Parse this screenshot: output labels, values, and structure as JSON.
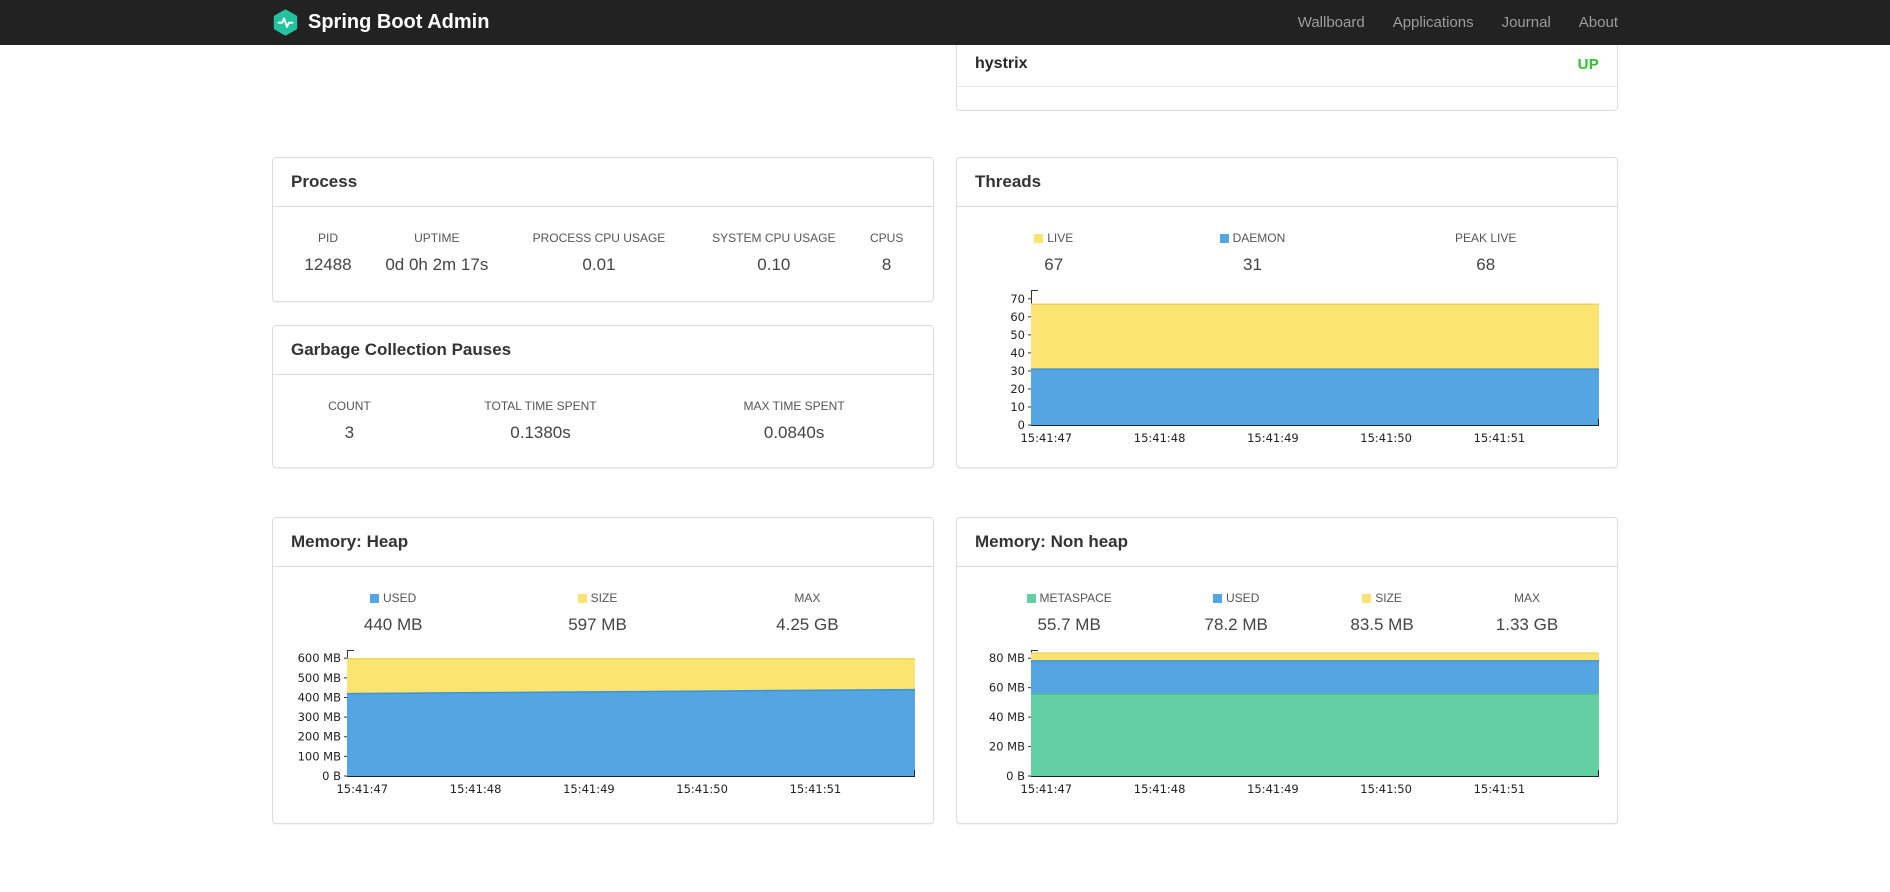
{
  "colors": {
    "brand_teal": "#23c3a0",
    "status_up": "#2dc22d",
    "series_yellow": "#fce473",
    "series_blue": "#53a6e1",
    "series_green": "#63d0a4"
  },
  "navbar": {
    "brand": "Spring Boot Admin",
    "items": [
      "Wallboard",
      "Applications",
      "Journal",
      "About"
    ]
  },
  "health": {
    "service_name": "hystrix",
    "status": "UP"
  },
  "process": {
    "title": "Process",
    "stats": [
      {
        "label": "PID",
        "value": "12488"
      },
      {
        "label": "UPTIME",
        "value": "0d 0h 2m 17s"
      },
      {
        "label": "PROCESS CPU USAGE",
        "value": "0.01"
      },
      {
        "label": "SYSTEM CPU USAGE",
        "value": "0.10"
      },
      {
        "label": "CPUS",
        "value": "8"
      }
    ]
  },
  "gc": {
    "title": "Garbage Collection Pauses",
    "stats": [
      {
        "label": "COUNT",
        "value": "3"
      },
      {
        "label": "TOTAL TIME SPENT",
        "value": "0.1380s"
      },
      {
        "label": "MAX TIME SPENT",
        "value": "0.0840s"
      }
    ]
  },
  "threads": {
    "title": "Threads",
    "legend": [
      {
        "label": "LIVE",
        "value": "67",
        "color": "#fce473"
      },
      {
        "label": "DAEMON",
        "value": "31",
        "color": "#53a6e1"
      },
      {
        "label": "PEAK LIVE",
        "value": "68"
      }
    ]
  },
  "memory_heap": {
    "title": "Memory: Heap",
    "legend": [
      {
        "label": "USED",
        "value": "440 MB",
        "color": "#53a6e1"
      },
      {
        "label": "SIZE",
        "value": "597 MB",
        "color": "#fce473"
      },
      {
        "label": "MAX",
        "value": "4.25 GB"
      }
    ]
  },
  "memory_nonheap": {
    "title": "Memory: Non heap",
    "legend": [
      {
        "label": "METASPACE",
        "value": "55.7 MB",
        "color": "#63d0a4"
      },
      {
        "label": "USED",
        "value": "78.2 MB",
        "color": "#53a6e1"
      },
      {
        "label": "SIZE",
        "value": "83.5 MB",
        "color": "#fce473"
      },
      {
        "label": "MAX",
        "value": "1.33 GB"
      }
    ]
  },
  "chart_data": [
    {
      "id": "threads",
      "type": "area",
      "title": "Threads",
      "xlabel": "",
      "ylabel": "",
      "ylim": [
        0,
        70
      ],
      "grid": false,
      "legend_position": "top",
      "x_labels": [
        "15:41:47",
        "15:41:48",
        "15:41:49",
        "15:41:50",
        "15:41:51"
      ],
      "y_ticks": [
        {
          "value": 0,
          "label": "0"
        },
        {
          "value": 10,
          "label": "10"
        },
        {
          "value": 20,
          "label": "20"
        },
        {
          "value": 30,
          "label": "30"
        },
        {
          "value": 40,
          "label": "40"
        },
        {
          "value": 50,
          "label": "50"
        },
        {
          "value": 60,
          "label": "60"
        },
        {
          "value": 70,
          "label": "70"
        }
      ],
      "series": [
        {
          "name": "LIVE",
          "color": "#fce473",
          "stroke": "#edd45e",
          "values": [
            67,
            67,
            67,
            67,
            67,
            67
          ]
        },
        {
          "name": "DAEMON",
          "color": "#53a6e1",
          "stroke": "#3d94d4",
          "values": [
            31,
            31,
            31,
            31,
            31,
            31
          ]
        }
      ]
    },
    {
      "id": "heap",
      "type": "area",
      "title": "Memory: Heap (values in MB)",
      "xlabel": "",
      "ylabel": "",
      "ylim": [
        0,
        600
      ],
      "grid": false,
      "legend_position": "top",
      "x_labels": [
        "15:41:47",
        "15:41:48",
        "15:41:49",
        "15:41:50",
        "15:41:51"
      ],
      "y_ticks": [
        {
          "value": 0,
          "label": "0 B"
        },
        {
          "value": 100,
          "label": "100 MB"
        },
        {
          "value": 200,
          "label": "200 MB"
        },
        {
          "value": 300,
          "label": "300 MB"
        },
        {
          "value": 400,
          "label": "400 MB"
        },
        {
          "value": 500,
          "label": "500 MB"
        },
        {
          "value": 600,
          "label": "600 MB"
        }
      ],
      "series": [
        {
          "name": "SIZE",
          "color": "#fce473",
          "stroke": "#edd45e",
          "values": [
            597,
            597,
            597,
            597,
            597,
            597
          ]
        },
        {
          "name": "USED",
          "color": "#53a6e1",
          "stroke": "#3d94d4",
          "values": [
            420,
            424,
            428,
            432,
            436,
            440
          ]
        }
      ]
    },
    {
      "id": "nonheap",
      "type": "area",
      "title": "Memory: Non heap (values in MB)",
      "xlabel": "",
      "ylabel": "",
      "ylim": [
        0,
        80
      ],
      "grid": false,
      "legend_position": "top",
      "x_labels": [
        "15:41:47",
        "15:41:48",
        "15:41:49",
        "15:41:50",
        "15:41:51"
      ],
      "y_ticks": [
        {
          "value": 0,
          "label": "0 B"
        },
        {
          "value": 20,
          "label": "20 MB"
        },
        {
          "value": 40,
          "label": "40 MB"
        },
        {
          "value": 60,
          "label": "60 MB"
        },
        {
          "value": 80,
          "label": "80 MB"
        }
      ],
      "series": [
        {
          "name": "SIZE",
          "color": "#fce473",
          "stroke": "#edd45e",
          "values": [
            83.5,
            83.5,
            83.5,
            83.5,
            83.5,
            83.5
          ]
        },
        {
          "name": "USED",
          "color": "#53a6e1",
          "stroke": "#3d94d4",
          "values": [
            78.2,
            78.2,
            78.2,
            78.2,
            78.2,
            78.2
          ]
        },
        {
          "name": "METASPACE",
          "color": "#63d0a4",
          "stroke": "#4cbf90",
          "values": [
            55.7,
            55.7,
            55.7,
            55.7,
            55.7,
            55.7
          ]
        }
      ]
    }
  ]
}
